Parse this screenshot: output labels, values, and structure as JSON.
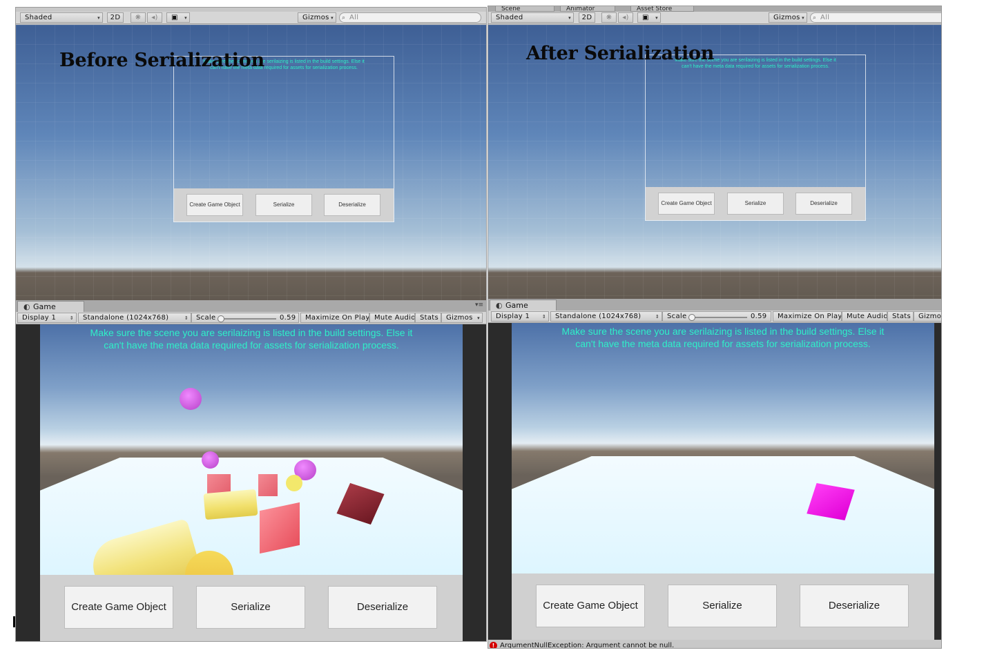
{
  "left": {
    "label": "Before Serialization",
    "scene_toolbar": {
      "shading": "Shaded",
      "mode_2d": "2D",
      "gizmos": "Gizmos",
      "search_placeholder": "All"
    },
    "scene_message": "Make sure the scene you are serilaizing is listed in the build settings. Else it can't have the meta data required for assets for serialization process.",
    "buttons": {
      "create": "Create Game Object",
      "serialize": "Serialize",
      "deserialize": "Deserialize"
    },
    "game_tab": "Game",
    "game_toolbar": {
      "display": "Display 1",
      "resolution": "Standalone (1024x768)",
      "scale_label": "Scale",
      "scale_value": "0.59",
      "maximize": "Maximize On Play",
      "mute": "Mute Audio",
      "stats": "Stats",
      "gizmos": "Gizmos"
    },
    "game_message": "Make sure the scene you are serilaizing is listed in the build settings. Else it can't have the meta data required for assets for serialization process.",
    "scene_objects": [
      "magenta-sphere",
      "magenta-sphere",
      "magenta-sphere",
      "red-cube",
      "red-cube",
      "red-cube",
      "dark-red-cube",
      "yellow-cylinder",
      "yellow-cylinder",
      "yellow-capsule"
    ]
  },
  "right": {
    "top_tabs": {
      "scene": "Scene",
      "animator": "Animator",
      "asset_store": "Asset Store"
    },
    "label": "After Serialization",
    "scene_toolbar": {
      "shading": "Shaded",
      "mode_2d": "2D",
      "gizmos": "Gizmos",
      "search_placeholder": "All"
    },
    "scene_message": "Make sure the scene you are serilaizing is listed in the build settings. Else it can't have the meta data required for assets for serialization process.",
    "buttons": {
      "create": "Create Game Object",
      "serialize": "Serialize",
      "deserialize": "Deserialize"
    },
    "game_tab": "Game",
    "game_toolbar": {
      "display": "Display 1",
      "resolution": "Standalone (1024x768)",
      "scale_label": "Scale",
      "scale_value": "0.59",
      "maximize": "Maximize On Play",
      "mute": "Mute Audio",
      "stats": "Stats",
      "gizmos": "Gizmos"
    },
    "game_message": "Make sure the scene you are serilaizing is listed in the build settings. Else it can't have the meta data required for assets for serialization process.",
    "scene_objects": [
      "magenta-cube"
    ],
    "console_error": "ArgumentNullException: Argument cannot be null."
  },
  "colors": {
    "message_text": "#2ff0c8",
    "toolbar_bg": "#d6d6d6",
    "button_bg": "#f2f2f2",
    "sphere": "#d45ae6",
    "cube_red": "#ef6f7a",
    "cube_dark": "#8b2430",
    "cylinder": "#f5e97a",
    "cube_magenta": "#ff00ee",
    "error": "#d40000"
  },
  "icons": [
    "sun-icon",
    "speaker-icon",
    "image-icon",
    "search-icon",
    "game-controller-icon",
    "menu-icon",
    "error-icon"
  ]
}
